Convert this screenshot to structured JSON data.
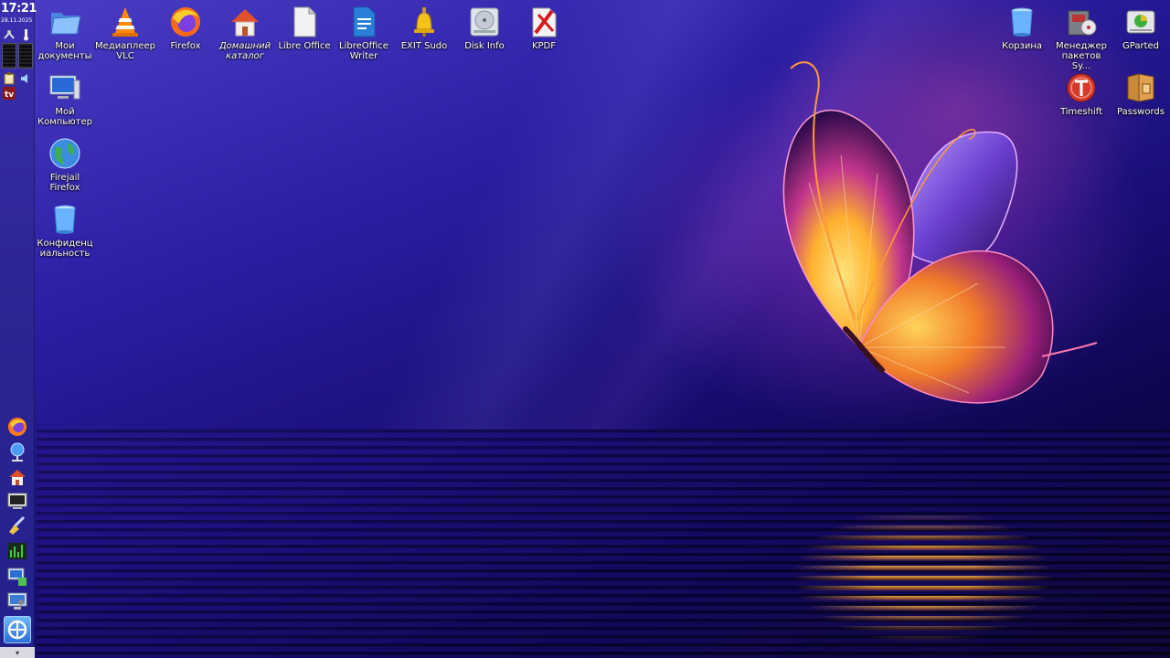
{
  "panel": {
    "clock_time": "17:21",
    "clock_date": "28.11.2025",
    "launchers": [
      {
        "icon": "firefox-icon"
      },
      {
        "icon": "network-icon"
      },
      {
        "icon": "home-folder-icon"
      },
      {
        "icon": "terminal-icon"
      },
      {
        "icon": "cleaner-brush-icon"
      },
      {
        "icon": "system-monitor-icon"
      },
      {
        "icon": "remote-desktop-icon"
      },
      {
        "icon": "display-settings-icon"
      }
    ],
    "start_icon": "start-menu-icon"
  },
  "desktop": {
    "left_icons": [
      {
        "label": "Мои документы",
        "icon": "documents-folder-icon"
      },
      {
        "label": "Мой Компьютер",
        "icon": "computer-icon"
      },
      {
        "label": "Firejail Firefox",
        "icon": "globe-icon"
      },
      {
        "label": "Конфиденциальность",
        "icon": "privacy-trash-icon"
      }
    ],
    "top_icons": [
      {
        "label": "Медиаплеер VLC",
        "icon": "vlc-icon"
      },
      {
        "label": "Firefox",
        "icon": "firefox-icon"
      },
      {
        "label": "Домашний каталог",
        "icon": "home-folder-icon"
      },
      {
        "label": "Libre Office",
        "icon": "libreoffice-icon"
      },
      {
        "label": "LibreOffice Writer",
        "icon": "writer-icon"
      },
      {
        "label": "EXIT Sudo",
        "icon": "bell-icon"
      },
      {
        "label": "Disk Info",
        "icon": "disk-icon"
      },
      {
        "label": "KPDF",
        "icon": "kpdf-icon"
      }
    ],
    "right_icons": [
      {
        "label": "Корзина",
        "icon": "trash-icon"
      },
      {
        "label": "Менеджер пакетов Sy...",
        "icon": "package-manager-icon"
      },
      {
        "label": "GParted",
        "icon": "gparted-icon"
      },
      {
        "label": "Timeshift",
        "icon": "timeshift-icon"
      },
      {
        "label": "Passwords",
        "icon": "passwords-icon"
      }
    ]
  }
}
